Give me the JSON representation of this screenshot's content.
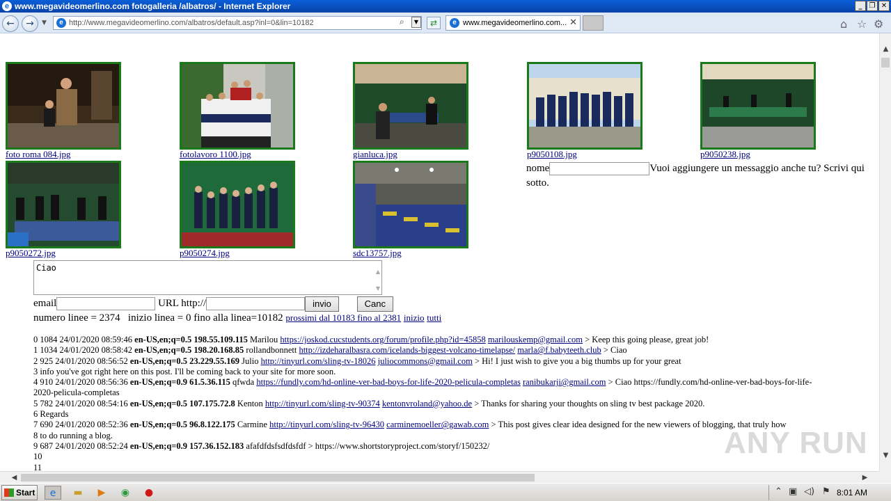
{
  "window": {
    "title": "www.megavideomerlino.com fotogalleria /albatros/ - Internet Explorer"
  },
  "browser": {
    "address": "http://www.megavideomerlino.com/albatros/default.asp?inl=0&lin=10182",
    "tab_title": "www.megavideomerlino.com..."
  },
  "gallery": [
    {
      "caption": "foto roma 084.jpg",
      "scene": "night-portrait"
    },
    {
      "caption": "fotolavoro 1100.jpg",
      "scene": "team-indoor"
    },
    {
      "caption": "gianluca.jpg",
      "scene": "pingpong-hall"
    },
    {
      "caption": "p9050108.jpg",
      "scene": "team-outdoor"
    },
    {
      "caption": "p9050238.jpg",
      "scene": "tent-tables"
    },
    {
      "caption": "p9050272.jpg",
      "scene": "table-players"
    },
    {
      "caption": "p9050274.jpg",
      "scene": "team-green"
    },
    {
      "caption": "sdc13757.jpg",
      "scene": "gym-hall"
    }
  ],
  "form": {
    "nome_label": "nome",
    "prompt": "Vuoi aggiungere un messaggio anche tu? Scrivi qui sotto.",
    "message": "Ciao",
    "email_label": "email",
    "url_label": "URL http://",
    "submit": "invio",
    "cancel": "Canc"
  },
  "stats": {
    "text": "numero linee = 2374   inizio linea = 0 fino alla linea=10182",
    "next_link": "prossimi dal 10183 fino al 2381",
    "start_link": "inizio",
    "all_link": "tutti"
  },
  "log": [
    {
      "pre": "0 1084 24/01/2020 08:59:46",
      "bold": "en-US,en;q=0.5 198.55.109.115",
      "name": "Marilou",
      "url": "https://joskod.cucstudents.org/forum/profile.php?id=45858",
      "email": "marilouskemp@gmail.com",
      "msg": "> Keep this going please, great job!"
    },
    {
      "pre": "1 1034 24/01/2020 08:58:42",
      "bold": "en-US,en;q=0.5 198.20.168.85",
      "name": "rollandbonnett",
      "url": "http://izdeharalbasra.com/icelands-biggest-volcano-timelapse/",
      "email": "marla@f.babyteeth.club",
      "msg": "> Ciao"
    },
    {
      "pre": "2 925 24/01/2020 08:56:52",
      "bold": "en-US,en;q=0.5 23.229.55.169",
      "name": "Julio",
      "url": "http://tinyurl.com/sling-tv-18026",
      "email": "juliocommons@gmail.com",
      "msg": "> Hi! I just wish to give you a big thumbs up for your great"
    },
    {
      "plain": "3 info you've got right here on this post. I'll be coming back to your site for more soon."
    },
    {
      "pre": "4 910 24/01/2020 08:56:36",
      "bold": "en-US,en;q=0.9 61.5.36.115",
      "name": "qfwda",
      "url": "https://fundly.com/hd-online-ver-bad-boys-for-life-2020-pelicula-completas",
      "email": "ranibukarji@gmail.com",
      "msg": "> Ciao https://fundly.com/hd-online-ver-bad-boys-for-life-"
    },
    {
      "plain": "2020-pelicula-completas"
    },
    {
      "pre": "5 782 24/01/2020 08:54:16",
      "bold": "en-US,en;q=0.5 107.175.72.8",
      "name": "Kenton",
      "url": "http://tinyurl.com/sling-tv-90374",
      "email": "kentonvroland@yahoo.de",
      "msg": "> Thanks for sharing your thoughts on sling tv best package 2020."
    },
    {
      "plain": "6 Regards"
    },
    {
      "pre": "7 690 24/01/2020 08:52:36",
      "bold": "en-US,en;q=0.5 96.8.122.175",
      "name": "Carmine",
      "url": "http://tinyurl.com/sling-tv-96430",
      "email": "carminemoeller@gawab.com",
      "msg": "> This post gives clear idea designed for the new viewers of blogging, that truly how"
    },
    {
      "plain": "8 to do running a blog."
    },
    {
      "pre": "9 687 24/01/2020 08:52:24",
      "bold": "en-US,en;q=0.9 157.36.152.183",
      "name": "afafdfdsfsdfdsfdf",
      "url": "",
      "email": "",
      "msg": "> https://www.shortstoryproject.com/storyf/150232/"
    },
    {
      "plain": "10"
    },
    {
      "plain": "11"
    }
  ],
  "watermark": "ANY RUN",
  "taskbar": {
    "start": "Start",
    "clock": "8:01 AM"
  }
}
